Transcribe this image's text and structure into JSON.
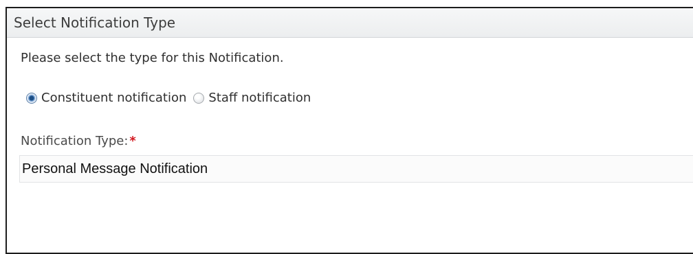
{
  "dialog": {
    "title": "Select Notification Type",
    "instructions": "Please select the type for this Notification."
  },
  "notification_kind": {
    "options": [
      {
        "label": "Constituent notification",
        "selected": true
      },
      {
        "label": "Staff notification",
        "selected": false
      }
    ]
  },
  "notification_type": {
    "label": "Notification Type:",
    "required_marker": "*",
    "value": "Personal Message Notification"
  },
  "colors": {
    "required": "#d2161e",
    "header_bg": "#eceeef",
    "border": "#1c1c1c"
  }
}
